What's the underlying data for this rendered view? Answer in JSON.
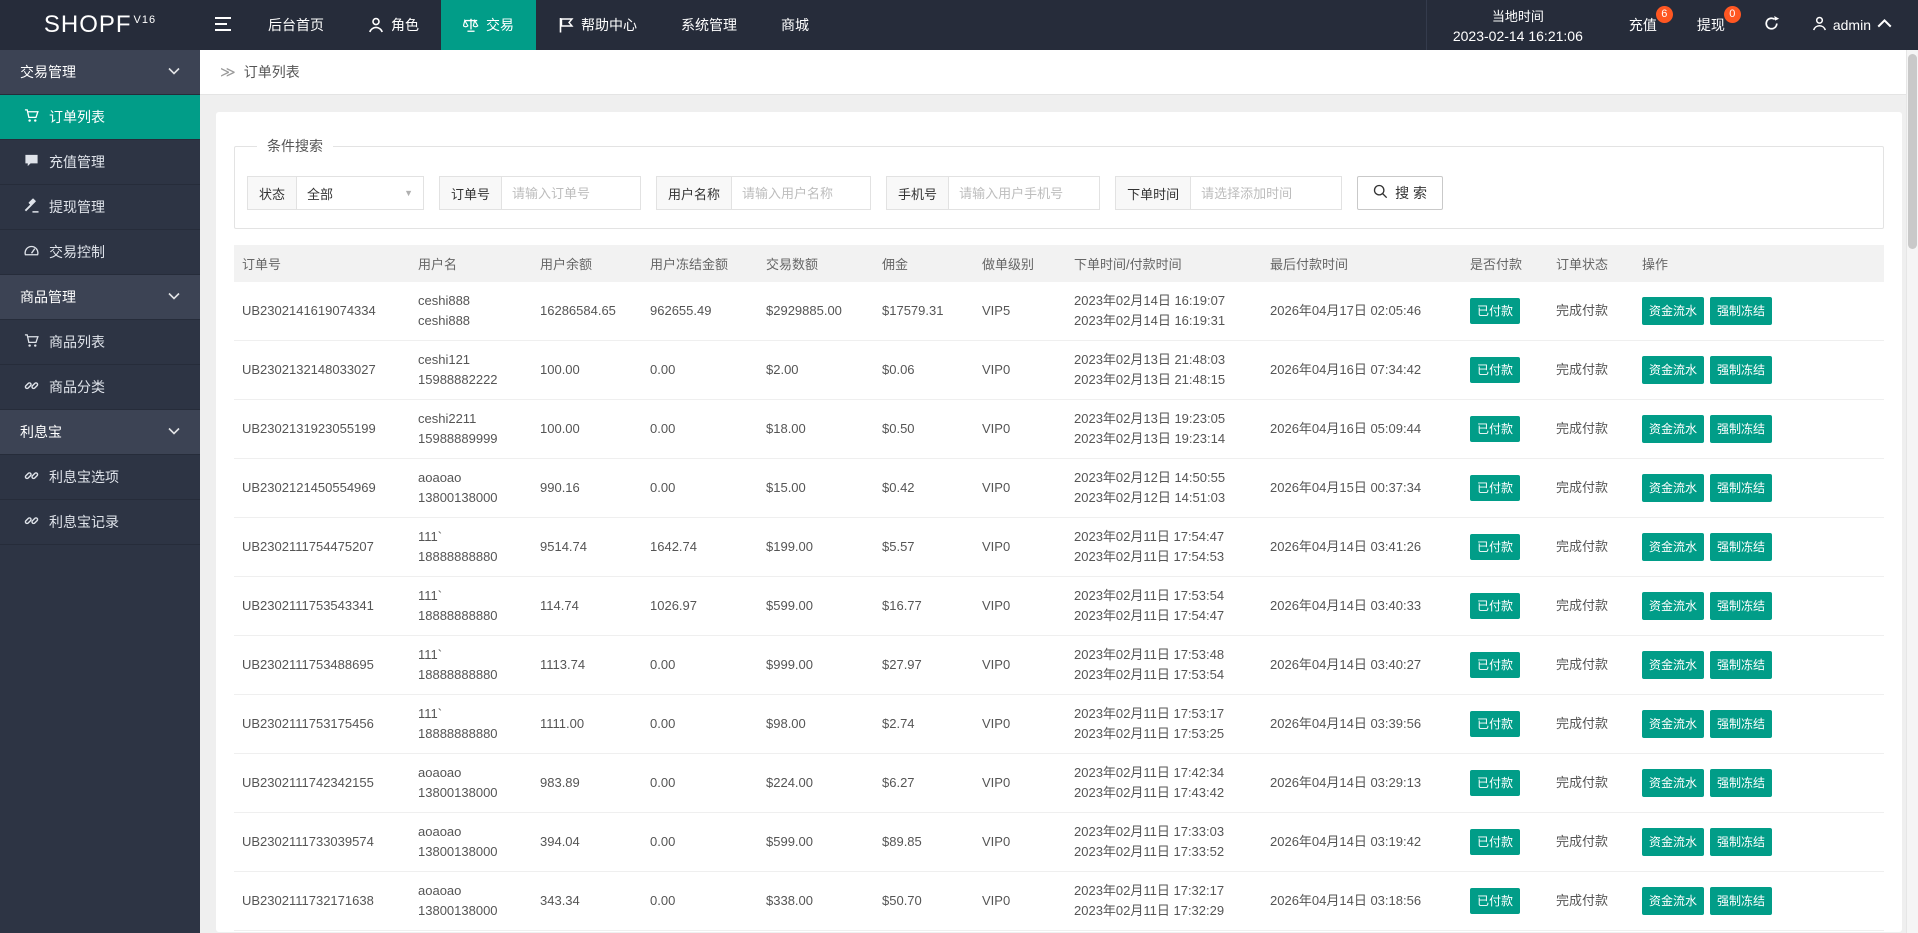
{
  "colors": {
    "accent": "#019d88",
    "badge": "#ff5722"
  },
  "topbar": {
    "logo": "SHOPF",
    "logo_version": "V16",
    "nav": [
      {
        "label": "后台首页",
        "icon": null,
        "active": false
      },
      {
        "label": "角色",
        "icon": "person",
        "active": false
      },
      {
        "label": "交易",
        "icon": "scale",
        "active": true
      },
      {
        "label": "帮助中心",
        "icon": "flag",
        "active": false
      },
      {
        "label": "系统管理",
        "icon": null,
        "active": false
      },
      {
        "label": "商城",
        "icon": null,
        "active": false
      }
    ],
    "local_time_label": "当地时间",
    "local_time_value": "2023-02-14 16:21:06",
    "recharge_label": "充值",
    "recharge_badge": "6",
    "withdraw_label": "提现",
    "withdraw_badge": "0",
    "username": "admin"
  },
  "sidebar": {
    "items": [
      {
        "type": "group",
        "label": "交易管理"
      },
      {
        "type": "item",
        "label": "订单列表",
        "icon": "cart",
        "active": true
      },
      {
        "type": "item",
        "label": "充值管理",
        "icon": "comment",
        "active": false
      },
      {
        "type": "item",
        "label": "提现管理",
        "icon": "gavel",
        "active": false
      },
      {
        "type": "item",
        "label": "交易控制",
        "icon": "gauge",
        "active": false
      },
      {
        "type": "group",
        "label": "商品管理"
      },
      {
        "type": "item",
        "label": "商品列表",
        "icon": "cart",
        "active": false
      },
      {
        "type": "item",
        "label": "商品分类",
        "icon": "link",
        "active": false
      },
      {
        "type": "group",
        "label": "利息宝"
      },
      {
        "type": "item",
        "label": "利息宝选项",
        "icon": "link",
        "active": false
      },
      {
        "type": "item",
        "label": "利息宝记录",
        "icon": "link",
        "active": false
      }
    ]
  },
  "breadcrumb": {
    "title": "订单列表"
  },
  "filters": {
    "legend": "条件搜索",
    "status_label": "状态",
    "status_value": "全部",
    "order_label": "订单号",
    "order_placeholder": "请输入订单号",
    "user_label": "用户名称",
    "user_placeholder": "请输入用户名称",
    "phone_label": "手机号",
    "phone_placeholder": "请输入用户手机号",
    "time_label": "下单时间",
    "time_placeholder": "请选择添加时间",
    "search_label": "搜 索"
  },
  "table": {
    "headers": [
      "订单号",
      "用户名",
      "用户余额",
      "用户冻结金额",
      "交易数额",
      "佣金",
      "做单级别",
      "下单时间/付款时间",
      "最后付款时间",
      "是否付款",
      "订单状态",
      "操作"
    ],
    "paid_badge": "已付款",
    "order_status": "完成付款",
    "action_flow": "资金流水",
    "action_freeze": "强制冻结",
    "rows": [
      {
        "order": "UB2302141619074334",
        "user1": "ceshi888",
        "user2": "ceshi888",
        "balance": "16286584.65",
        "frozen": "962655.49",
        "amount": "$2929885.00",
        "commission": "$17579.31",
        "level": "VIP5",
        "t1": "2023年02月14日 16:19:07",
        "t2": "2023年02月14日 16:19:31",
        "last": "2026年04月17日 02:05:46"
      },
      {
        "order": "UB2302132148033027",
        "user1": "ceshi121",
        "user2": "15988882222",
        "balance": "100.00",
        "frozen": "0.00",
        "amount": "$2.00",
        "commission": "$0.06",
        "level": "VIP0",
        "t1": "2023年02月13日 21:48:03",
        "t2": "2023年02月13日 21:48:15",
        "last": "2026年04月16日 07:34:42"
      },
      {
        "order": "UB2302131923055199",
        "user1": "ceshi2211",
        "user2": "15988889999",
        "balance": "100.00",
        "frozen": "0.00",
        "amount": "$18.00",
        "commission": "$0.50",
        "level": "VIP0",
        "t1": "2023年02月13日 19:23:05",
        "t2": "2023年02月13日 19:23:14",
        "last": "2026年04月16日 05:09:44"
      },
      {
        "order": "UB2302121450554969",
        "user1": "aoaoao",
        "user2": "13800138000",
        "balance": "990.16",
        "frozen": "0.00",
        "amount": "$15.00",
        "commission": "$0.42",
        "level": "VIP0",
        "t1": "2023年02月12日 14:50:55",
        "t2": "2023年02月12日 14:51:03",
        "last": "2026年04月15日 00:37:34"
      },
      {
        "order": "UB2302111754475207",
        "user1": "111`",
        "user2": "18888888880",
        "balance": "9514.74",
        "frozen": "1642.74",
        "amount": "$199.00",
        "commission": "$5.57",
        "level": "VIP0",
        "t1": "2023年02月11日 17:54:47",
        "t2": "2023年02月11日 17:54:53",
        "last": "2026年04月14日 03:41:26"
      },
      {
        "order": "UB2302111753543341",
        "user1": "111`",
        "user2": "18888888880",
        "balance": "114.74",
        "frozen": "1026.97",
        "amount": "$599.00",
        "commission": "$16.77",
        "level": "VIP0",
        "t1": "2023年02月11日 17:53:54",
        "t2": "2023年02月11日 17:54:47",
        "last": "2026年04月14日 03:40:33"
      },
      {
        "order": "UB2302111753488695",
        "user1": "111`",
        "user2": "18888888880",
        "balance": "1113.74",
        "frozen": "0.00",
        "amount": "$999.00",
        "commission": "$27.97",
        "level": "VIP0",
        "t1": "2023年02月11日 17:53:48",
        "t2": "2023年02月11日 17:53:54",
        "last": "2026年04月14日 03:40:27"
      },
      {
        "order": "UB2302111753175456",
        "user1": "111`",
        "user2": "18888888880",
        "balance": "1111.00",
        "frozen": "0.00",
        "amount": "$98.00",
        "commission": "$2.74",
        "level": "VIP0",
        "t1": "2023年02月11日 17:53:17",
        "t2": "2023年02月11日 17:53:25",
        "last": "2026年04月14日 03:39:56"
      },
      {
        "order": "UB2302111742342155",
        "user1": "aoaoao",
        "user2": "13800138000",
        "balance": "983.89",
        "frozen": "0.00",
        "amount": "$224.00",
        "commission": "$6.27",
        "level": "VIP0",
        "t1": "2023年02月11日 17:42:34",
        "t2": "2023年02月11日 17:43:42",
        "last": "2026年04月14日 03:29:13"
      },
      {
        "order": "UB2302111733039574",
        "user1": "aoaoao",
        "user2": "13800138000",
        "balance": "394.04",
        "frozen": "0.00",
        "amount": "$599.00",
        "commission": "$89.85",
        "level": "VIP0",
        "t1": "2023年02月11日 17:33:03",
        "t2": "2023年02月11日 17:33:52",
        "last": "2026年04月14日 03:19:42"
      },
      {
        "order": "UB2302111732171638",
        "user1": "aoaoao",
        "user2": "13800138000",
        "balance": "343.34",
        "frozen": "0.00",
        "amount": "$338.00",
        "commission": "$50.70",
        "level": "VIP0",
        "t1": "2023年02月11日 17:32:17",
        "t2": "2023年02月11日 17:32:29",
        "last": "2026年04月14日 03:18:56"
      }
    ]
  }
}
